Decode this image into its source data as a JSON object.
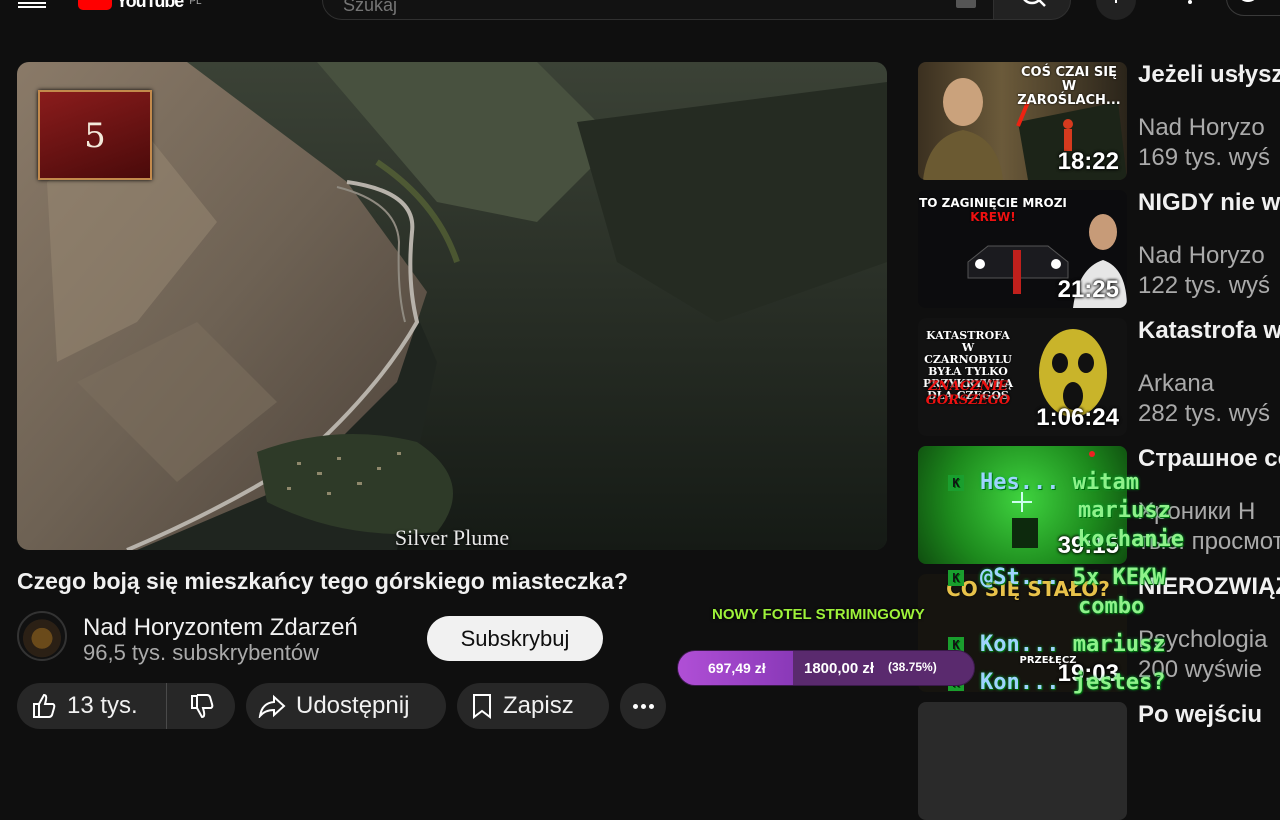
{
  "header": {
    "logo_text": "YouTube",
    "country_code": "PL",
    "search_placeholder": "Szukaj"
  },
  "player": {
    "chapter_number": "5",
    "place_caption": "Silver Plume"
  },
  "video": {
    "title": "Czego boją się mieszkańcy tego górskiego miasteczka?",
    "channel_name": "Nad Horyzontem Zdarzeń",
    "subscribers": "96,5 tys. subskrybentów",
    "subscribe_label": "Subskrybuj",
    "likes": "13 tys.",
    "share_label": "Udostępnij",
    "save_label": "Zapisz"
  },
  "recommendations": [
    {
      "title": "Jeżeli usłyszysz w lesie ten me",
      "channel": "Nad Horyzo",
      "views": "169 tys. wyś",
      "duration": "18:22",
      "thumb_text": "COŚ CZAI SIĘ W ZAROŚLACH..."
    },
    {
      "title": "NIGDY nie wracaj do domu, mime",
      "channel": "Nad Horyzo",
      "views": "122 tys. wyś",
      "duration": "21:25",
      "thumb_text": "TO ZAGINIĘCIE MROZI",
      "thumb_text_red": "KREW!"
    },
    {
      "title": "Katastrofa w Czarnobylu",
      "channel": "Arkana",
      "views": "282 tys. wyś",
      "duration": "1:06:24",
      "thumb_text": "KATASTROFA W CZARNOBYLU BYŁA TYLKO PRZYKRYWKĄ DLA CZEGOŚ",
      "thumb_text_red": "ZNACZNIE GORSZEGO"
    },
    {
      "title": "Страшное сообщество к",
      "channel": "Хроники Н",
      "views": "тыс. просмотров",
      "duration": "39:15"
    },
    {
      "title": "NIEROZWIĄZANA TAJEMNICA",
      "channel": "Psychologia",
      "views": "200 wyświe",
      "duration": "19:03",
      "thumb_text": "CO SIĘ STAŁO?",
      "thumb_sub": "PRZEŁĘCZ"
    },
    {
      "title": "Po wejściu"
    }
  ],
  "stream_overlay": {
    "chat": [
      {
        "nick": "Hes...",
        "msg": "witam"
      },
      {
        "nick": "",
        "msg": "mariusz"
      },
      {
        "nick": "",
        "msg": "kochanie"
      },
      {
        "nick": "",
        "msg": ""
      },
      {
        "nick": "@St...",
        "msg": "5x KEKW"
      },
      {
        "nick": "",
        "msg": "combo"
      },
      {
        "nick": "Kon...",
        "msg": "mariusz"
      },
      {
        "nick": "Kon...",
        "msg": "jestes?"
      }
    ],
    "goal_title": "NOWY FOTEL STRIMINGOWY",
    "goal_current": "697,49 zł",
    "goal_target": "1800,00 zł",
    "goal_percent": "(38.75%)",
    "goal_fraction": 0.3875,
    "colors": {
      "chat": "#8ef28a",
      "nick": "#9fd4ff",
      "goal_fill": "#b04fd6",
      "goal_title": "#9ef23a"
    }
  }
}
